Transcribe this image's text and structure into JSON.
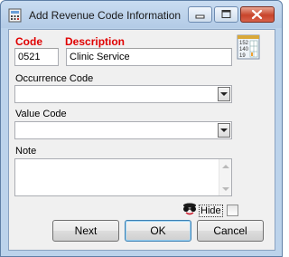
{
  "window": {
    "title": "Add Revenue Code Information"
  },
  "title_buttons": {
    "minimize_icon": "minimize-icon",
    "maximize_icon": "maximize-icon",
    "close_icon": "close-icon"
  },
  "form": {
    "code_label": "Code",
    "code_value": "0521",
    "description_label": "Description",
    "description_value": "Clinic Service",
    "occurrence_label": "Occurrence Code",
    "occurrence_value": "",
    "value_code_label": "Value Code",
    "value_code_value": "",
    "note_label": "Note",
    "note_value": "",
    "hide_label": "Hide",
    "hide_checked": false
  },
  "buttons": {
    "next": "Next",
    "ok": "OK",
    "cancel": "Cancel"
  },
  "colors": {
    "required_label": "#e00000",
    "title_bar": "#bcd3eb",
    "close_button": "#c8442b"
  }
}
